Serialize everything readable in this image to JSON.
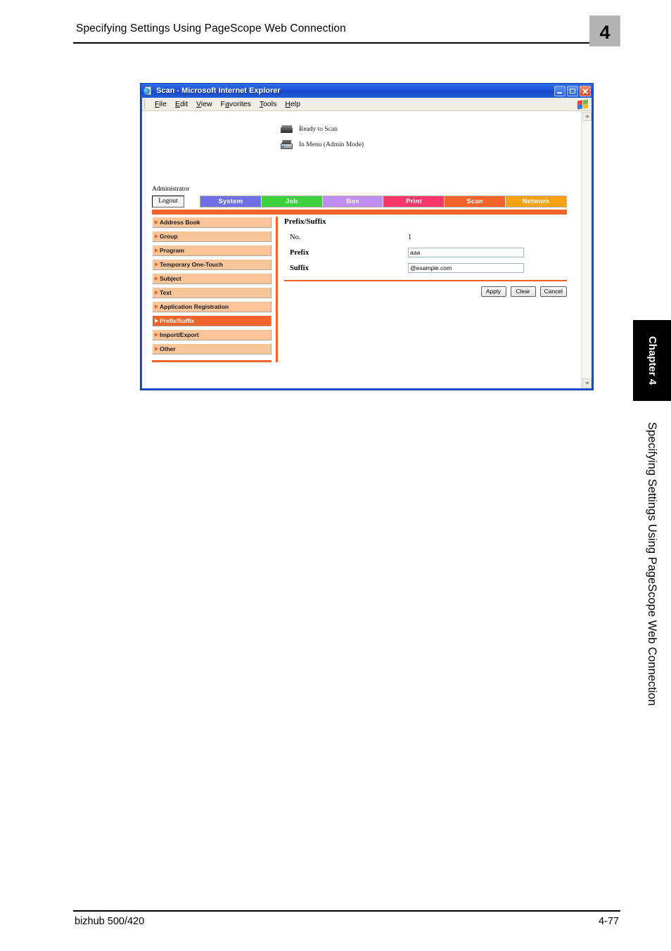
{
  "page_header": {
    "title": "Specifying Settings Using PageScope Web Connection",
    "chapter_number": "4"
  },
  "page_footer": {
    "model": "bizhub 500/420",
    "page_number": "4-77"
  },
  "side_tabs": {
    "chapter_tab": "Chapter 4",
    "vertical_label": "Specifying Settings Using PageScope Web Connection"
  },
  "browser": {
    "title": "Scan - Microsoft Internet Explorer",
    "title_icon": "ie-document-icon",
    "window_buttons": {
      "minimize": "minimize-icon",
      "maximize": "maximize-icon",
      "close": "close-icon"
    },
    "menu_items": [
      {
        "label": "File",
        "accel": "F"
      },
      {
        "label": "Edit",
        "accel": "E"
      },
      {
        "label": "View",
        "accel": "V"
      },
      {
        "label": "Favorites",
        "accel": "a"
      },
      {
        "label": "Tools",
        "accel": "T"
      },
      {
        "label": "Help",
        "accel": "H"
      }
    ],
    "brand_icon": "windows-flag-icon",
    "scrollbar": {
      "up_arrow": "scroll-up-icon",
      "down_arrow": "scroll-down-icon"
    }
  },
  "webpage": {
    "status_rows": [
      {
        "icon": "scanner-icon",
        "text": "Ready to Scan"
      },
      {
        "icon": "printer-icon",
        "text": "In Menu (Admin Mode)"
      }
    ],
    "user_label": "Administrator",
    "logout_label": "Logout",
    "nav_tabs": [
      {
        "label": "System",
        "color": "#6f6fe8"
      },
      {
        "label": "Job",
        "color": "#3ed13e"
      },
      {
        "label": "Box",
        "color": "#c08ef0"
      },
      {
        "label": "Print",
        "color": "#f5376b"
      },
      {
        "label": "Scan",
        "color": "#f2632a"
      },
      {
        "label": "Network",
        "color": "#f9a117"
      }
    ],
    "accent_color": "#f2632a",
    "sidebar_items": [
      {
        "label": "Address Book",
        "active": false
      },
      {
        "label": "Group",
        "active": false
      },
      {
        "label": "Program",
        "active": false
      },
      {
        "label": "Temporary One-Touch",
        "active": false
      },
      {
        "label": "Subject",
        "active": false
      },
      {
        "label": "Text",
        "active": false
      },
      {
        "label": "Application Registration",
        "active": false
      },
      {
        "label": "Prefix/Suffix",
        "active": true
      },
      {
        "label": "Import/Export",
        "active": false
      },
      {
        "label": "Other",
        "active": false
      }
    ],
    "main": {
      "title": "Prefix/Suffix",
      "fields": [
        {
          "label": "No.",
          "type": "text",
          "value": "1"
        },
        {
          "label": "Prefix",
          "type": "input",
          "value": "aaa"
        },
        {
          "label": "Suffix",
          "type": "input",
          "value": "@example.com"
        }
      ],
      "buttons": [
        {
          "label": "Apply"
        },
        {
          "label": "Clear"
        },
        {
          "label": "Cancel"
        }
      ]
    }
  }
}
